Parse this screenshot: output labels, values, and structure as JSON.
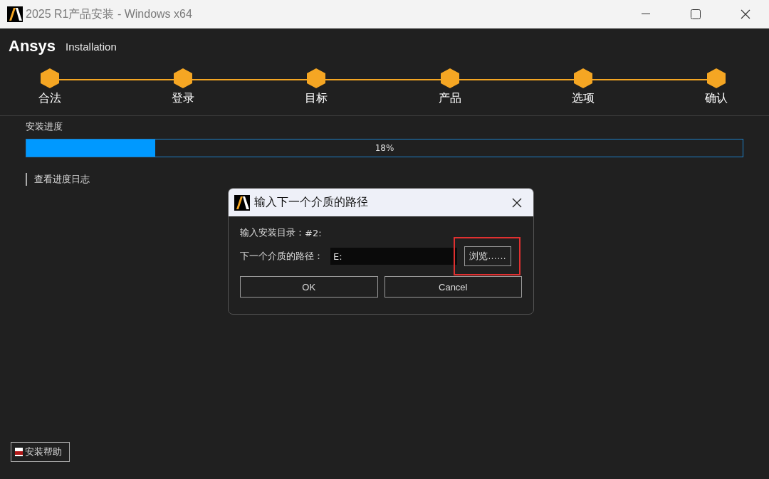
{
  "window": {
    "title": "2025 R1产品安装 - Windows x64"
  },
  "header": {
    "brand": "Ansys",
    "subtitle": "Installation"
  },
  "steps": [
    {
      "label": "合法"
    },
    {
      "label": "登录"
    },
    {
      "label": "目标"
    },
    {
      "label": "产品"
    },
    {
      "label": "选项"
    },
    {
      "label": "确认"
    }
  ],
  "progress": {
    "label": "安装进度",
    "level": 0.18,
    "reading": "18%"
  },
  "log_link": "查看进度日志",
  "help_button": "安装帮助",
  "dialog": {
    "title": "输入下一个介质的路径",
    "info_label": "输入安装目录：",
    "info_value": "#2:",
    "path_label": "下一个介质的路径：",
    "path_value": "E:",
    "browse_button": "浏览……",
    "browse_highlighted": true,
    "buttons": [
      "OK",
      "Cancel"
    ]
  }
}
